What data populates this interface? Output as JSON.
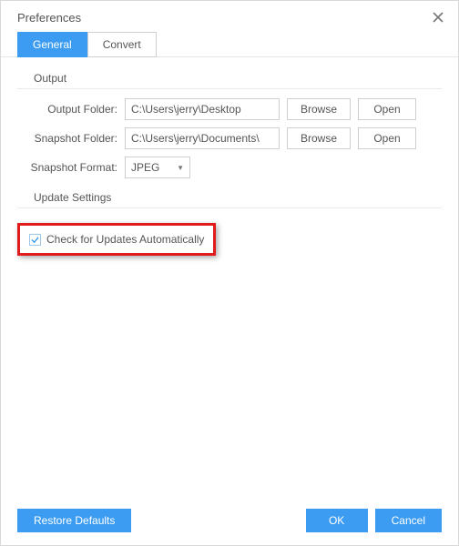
{
  "window": {
    "title": "Preferences"
  },
  "tabs": {
    "general": "General",
    "convert": "Convert"
  },
  "output": {
    "section_title": "Output",
    "output_folder_label": "Output Folder:",
    "output_folder_value": "C:\\Users\\jerry\\Desktop",
    "snapshot_folder_label": "Snapshot Folder:",
    "snapshot_folder_value": "C:\\Users\\jerry\\Documents\\",
    "snapshot_format_label": "Snapshot Format:",
    "snapshot_format_value": "JPEG",
    "browse_label": "Browse",
    "open_label": "Open"
  },
  "update": {
    "section_title": "Update Settings",
    "check_updates_label": "Check for Updates Automatically"
  },
  "footer": {
    "restore_defaults": "Restore Defaults",
    "ok": "OK",
    "cancel": "Cancel"
  }
}
